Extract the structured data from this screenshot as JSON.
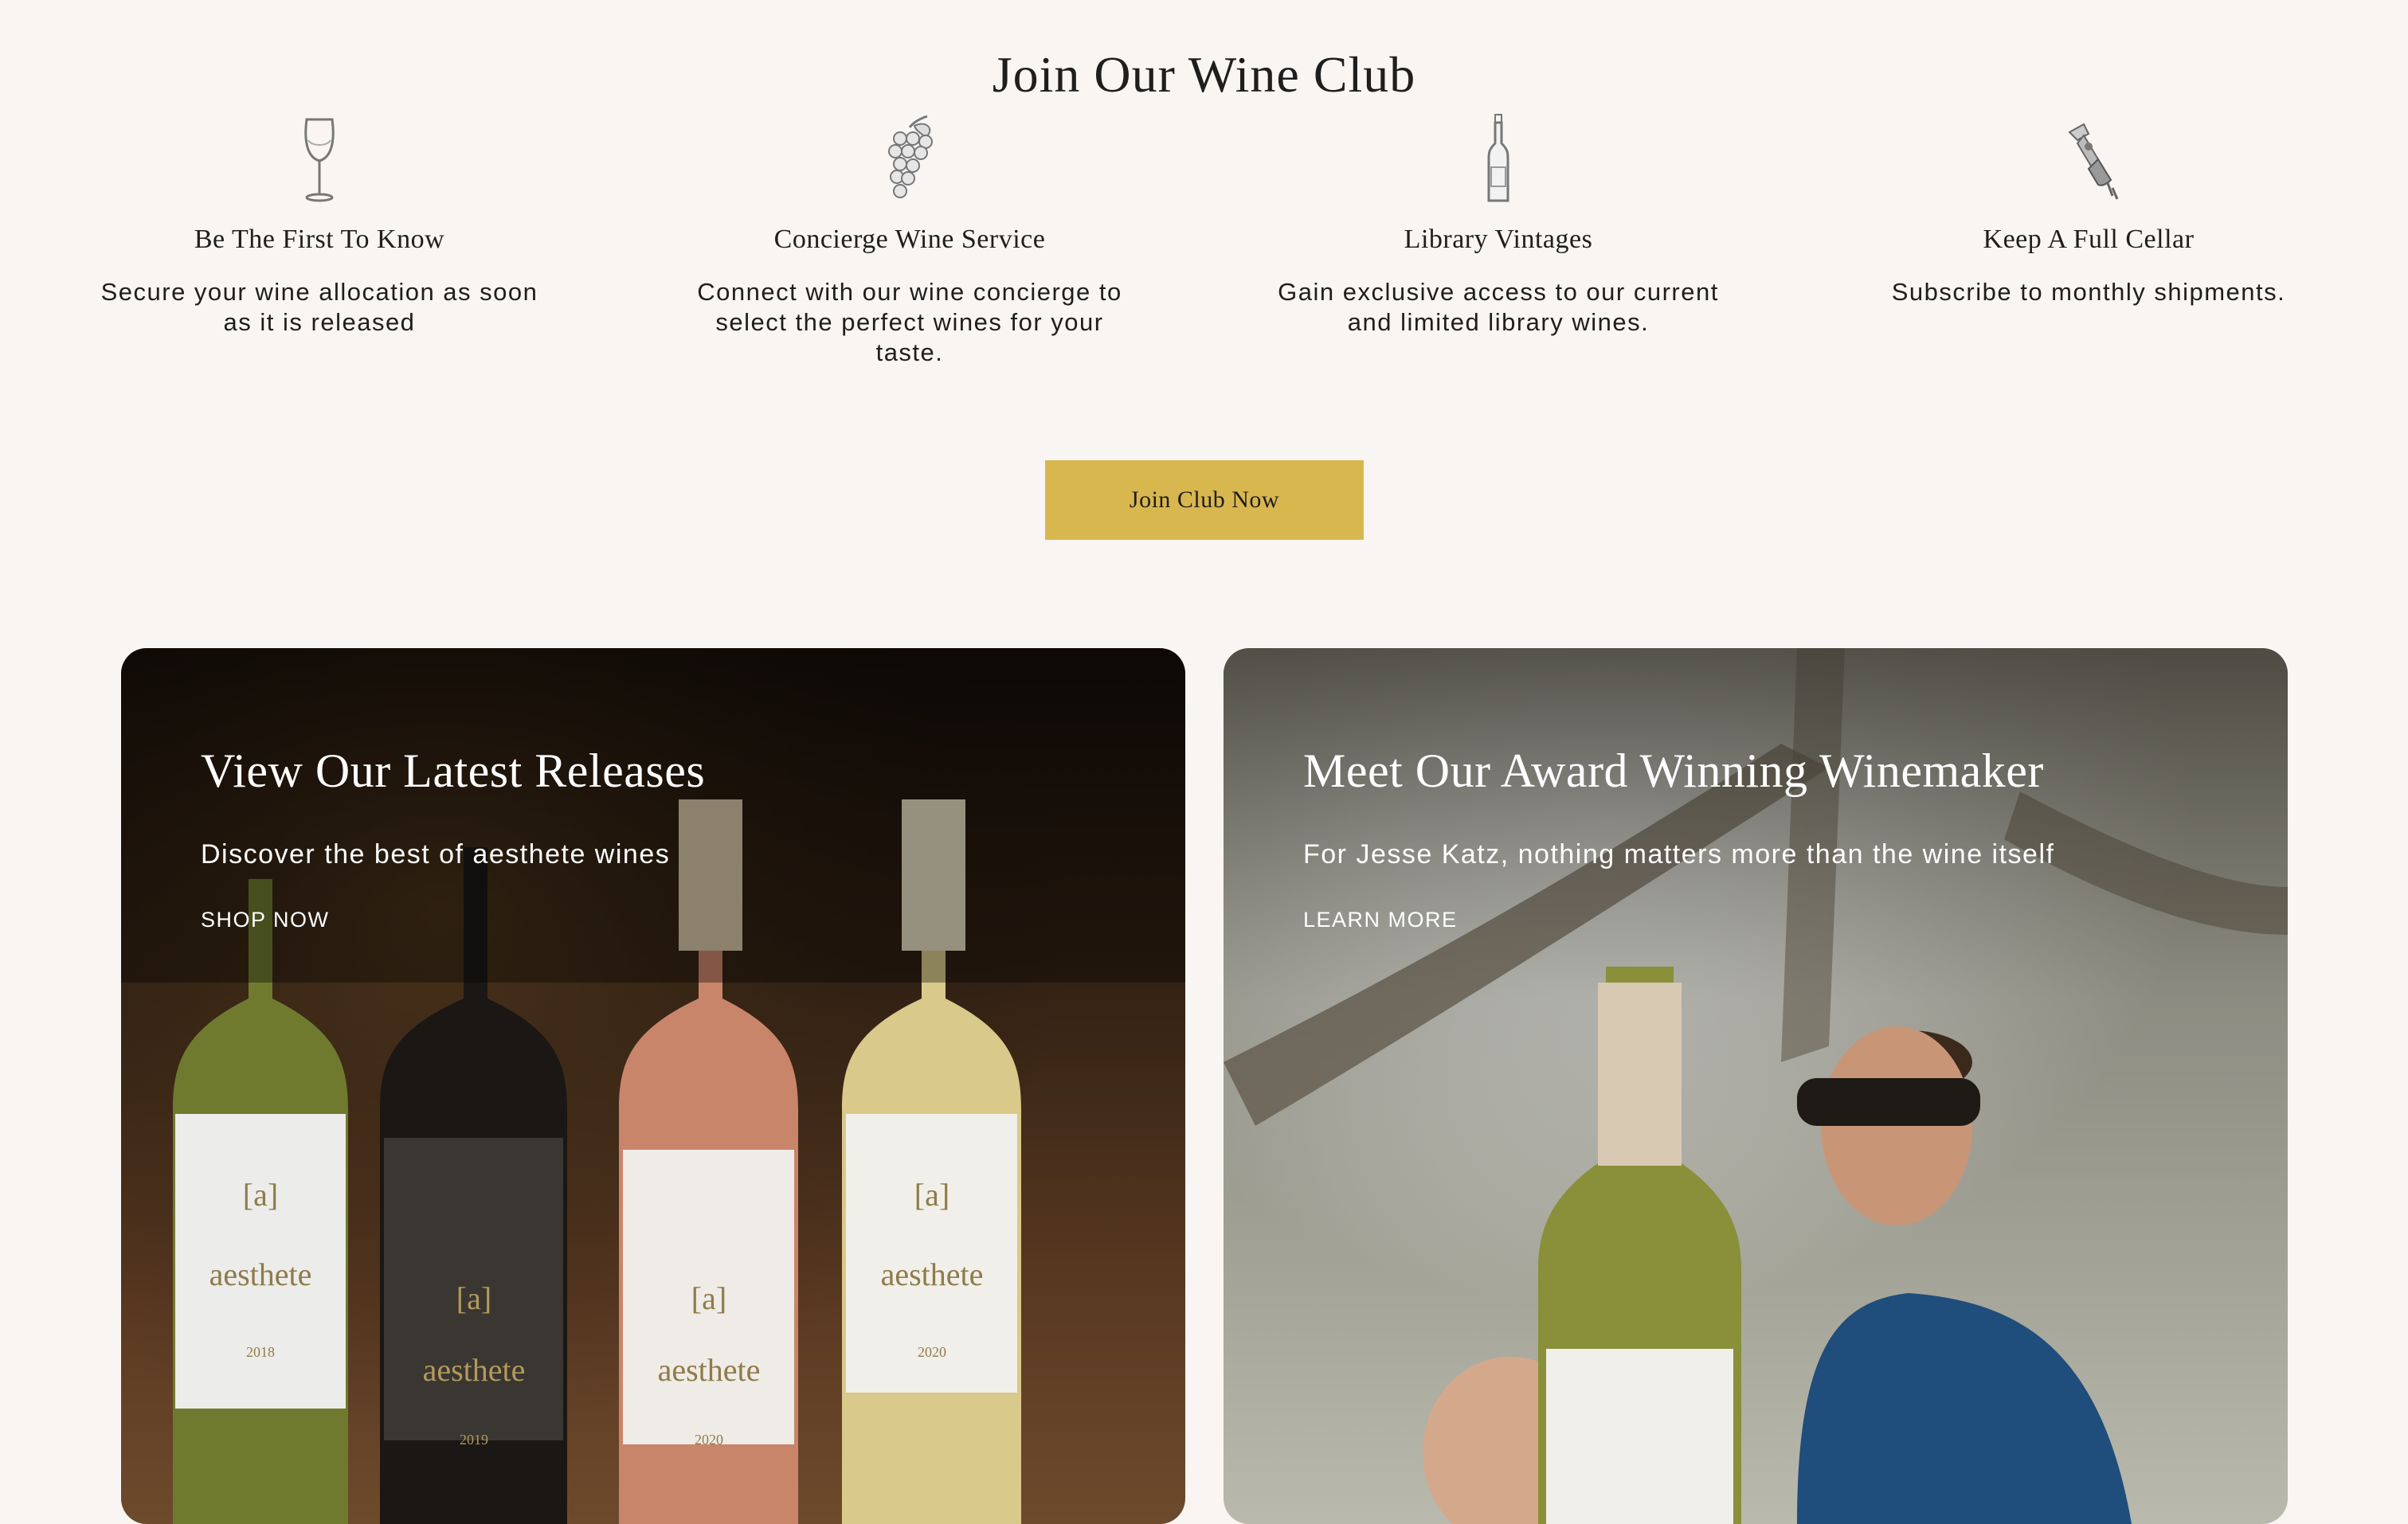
{
  "club": {
    "title": "Join Our Wine Club",
    "features": [
      {
        "icon": "wine-glass-icon",
        "title": "Be The First To Know",
        "desc": "Secure your wine allocation as soon as it is released"
      },
      {
        "icon": "grapes-icon",
        "title": "Concierge Wine Service",
        "desc": "Connect with our wine concierge to select the perfect wines for your taste."
      },
      {
        "icon": "wine-bottle-icon",
        "title": "Library Vintages",
        "desc": "Gain exclusive access to our current and limited library wines."
      },
      {
        "icon": "corkscrew-icon",
        "title": "Keep A Full Cellar",
        "desc": "Subscribe to monthly shipments."
      }
    ],
    "cta": "Join Club Now",
    "accent": "#d9b74f"
  },
  "cards": {
    "releases": {
      "title": "View Our Latest Releases",
      "subtitle": "Discover the best of aesthete wines",
      "link": "SHOP NOW"
    },
    "winemaker": {
      "title": "Meet Our Award Winning Winemaker",
      "subtitle": "For Jesse Katz, nothing matters more than the wine itself",
      "link": "LEARN MORE"
    }
  },
  "labels": {
    "brand_mark": "[a]",
    "brand_name": "aesthete",
    "bottle_vintages": [
      "2018",
      "2019",
      "2020",
      "2020"
    ]
  }
}
